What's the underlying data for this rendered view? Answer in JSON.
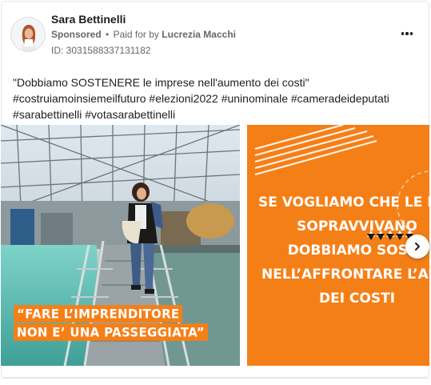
{
  "colors": {
    "accent_orange": "#f57f17",
    "text_primary": "#1c1e21",
    "text_secondary": "#65676b"
  },
  "header": {
    "page_name": "Sara Bettinelli",
    "sponsored_label": "Sponsored",
    "separator": "•",
    "paid_for_prefix": "Paid for by",
    "payer_name": "Lucrezia Macchi",
    "ad_id": "ID: 3031588337131182",
    "more_icon": "more-horizontal-icon"
  },
  "post": {
    "lines": [
      "\"Dobbiamo SOSTENERE le imprese nell'aumento dei costi\"",
      "#costruiamoinsiemeilfuturo #elezioni2022 #uninominale #cameradeideputati",
      "#sarabettinelli #votasarabettinelli"
    ]
  },
  "carousel": {
    "slide1": {
      "caption_lines": [
        "“FARE L’IMPRENDITORE",
        "NON E’ UNA PASSEGGIATA”"
      ]
    },
    "slide2": {
      "text_lines": [
        "SE VOGLIAMO CHE LE IMP",
        "SOPRAVVIVANO",
        "DOBBIAMO SOSTE",
        "NELL’AFFRONTARE L’AUM",
        "DEI COSTI"
      ]
    },
    "next_icon": "chevron-right-icon"
  }
}
